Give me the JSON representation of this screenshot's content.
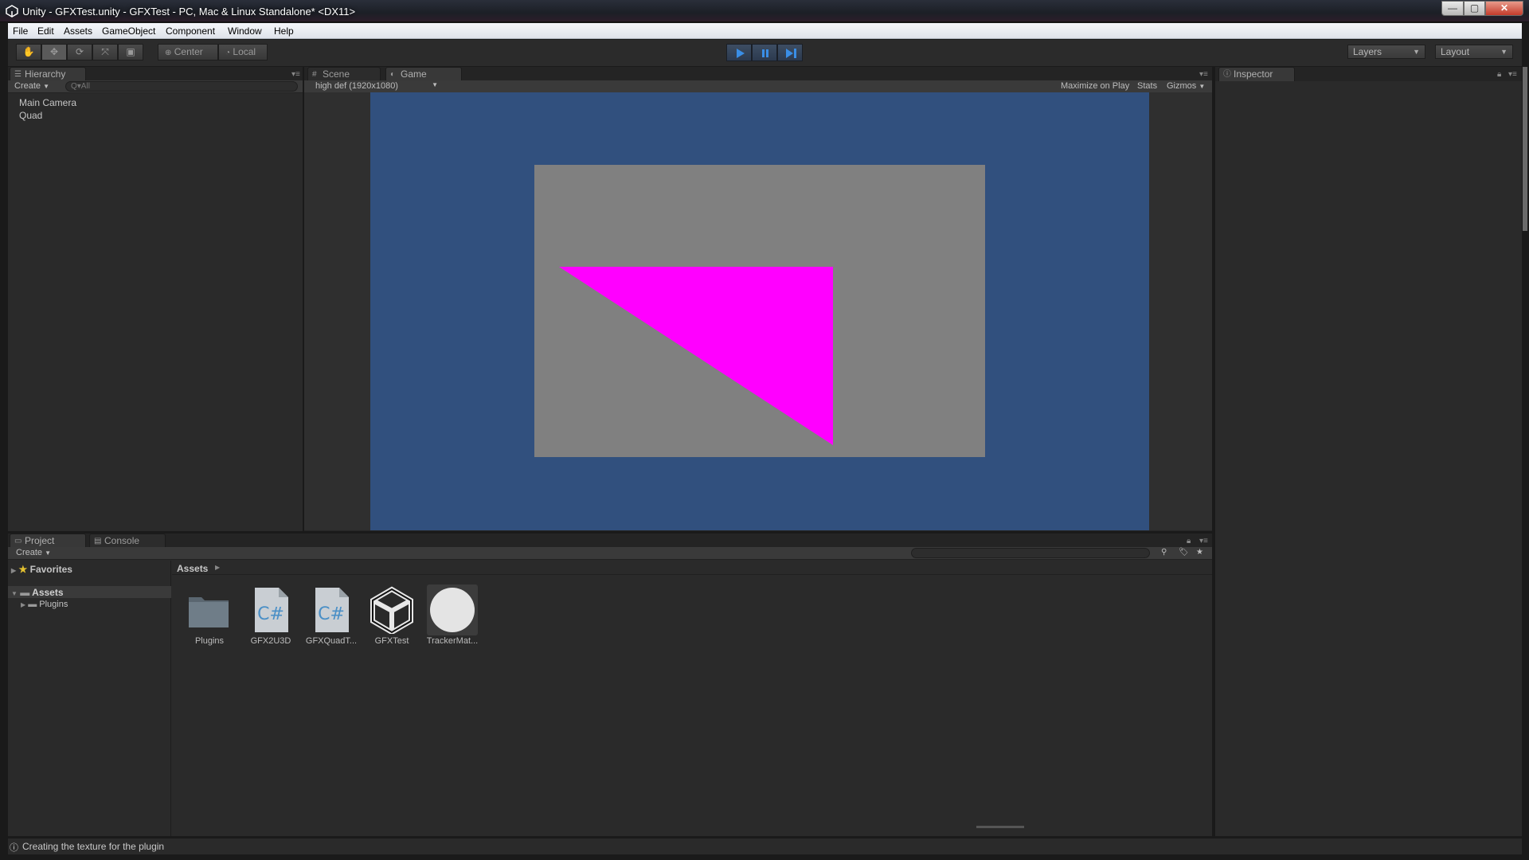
{
  "window": {
    "title": "Unity - GFXTest.unity - GFXTest - PC, Mac & Linux Standalone* <DX11>",
    "min_glyph": "—",
    "max_glyph": "▢",
    "close_glyph": "✕"
  },
  "menu": [
    "File",
    "Edit",
    "Assets",
    "GameObject",
    "Component",
    "Window",
    "Help"
  ],
  "toolbar": {
    "pivot_label": "Center",
    "space_label": "Local",
    "layers_label": "Layers",
    "layout_label": "Layout"
  },
  "hierarchy": {
    "tab": "Hierarchy",
    "create": "Create",
    "search_placeholder": "Q▾All",
    "items": [
      "Main Camera",
      "Quad"
    ]
  },
  "center_tabs": {
    "scene": "Scene",
    "game": "Game",
    "resolution": "high def (1920x1080)",
    "maximize": "Maximize on Play",
    "stats": "Stats",
    "gizmos": "Gizmos"
  },
  "game_view": {
    "background_color": "#31507e",
    "quad_color": "#808080",
    "triangle_color": "#ff00ff"
  },
  "inspector": {
    "tab": "Inspector"
  },
  "project": {
    "tab_project": "Project",
    "tab_console": "Console",
    "create": "Create",
    "favorites": "Favorites",
    "tree_assets": "Assets",
    "tree_plugins": "Plugins",
    "breadcrumb": "Assets",
    "assets": [
      {
        "label": "Plugins",
        "icon": "folder-icon"
      },
      {
        "label": "GFX2U3D",
        "icon": "csharp-script-icon"
      },
      {
        "label": "GFXQuadT...",
        "icon": "csharp-script-icon"
      },
      {
        "label": "GFXTest",
        "icon": "unity-scene-icon"
      },
      {
        "label": "TrackerMat...",
        "icon": "material-sphere-icon"
      }
    ]
  },
  "status": {
    "message": "Creating the texture for the plugin"
  }
}
